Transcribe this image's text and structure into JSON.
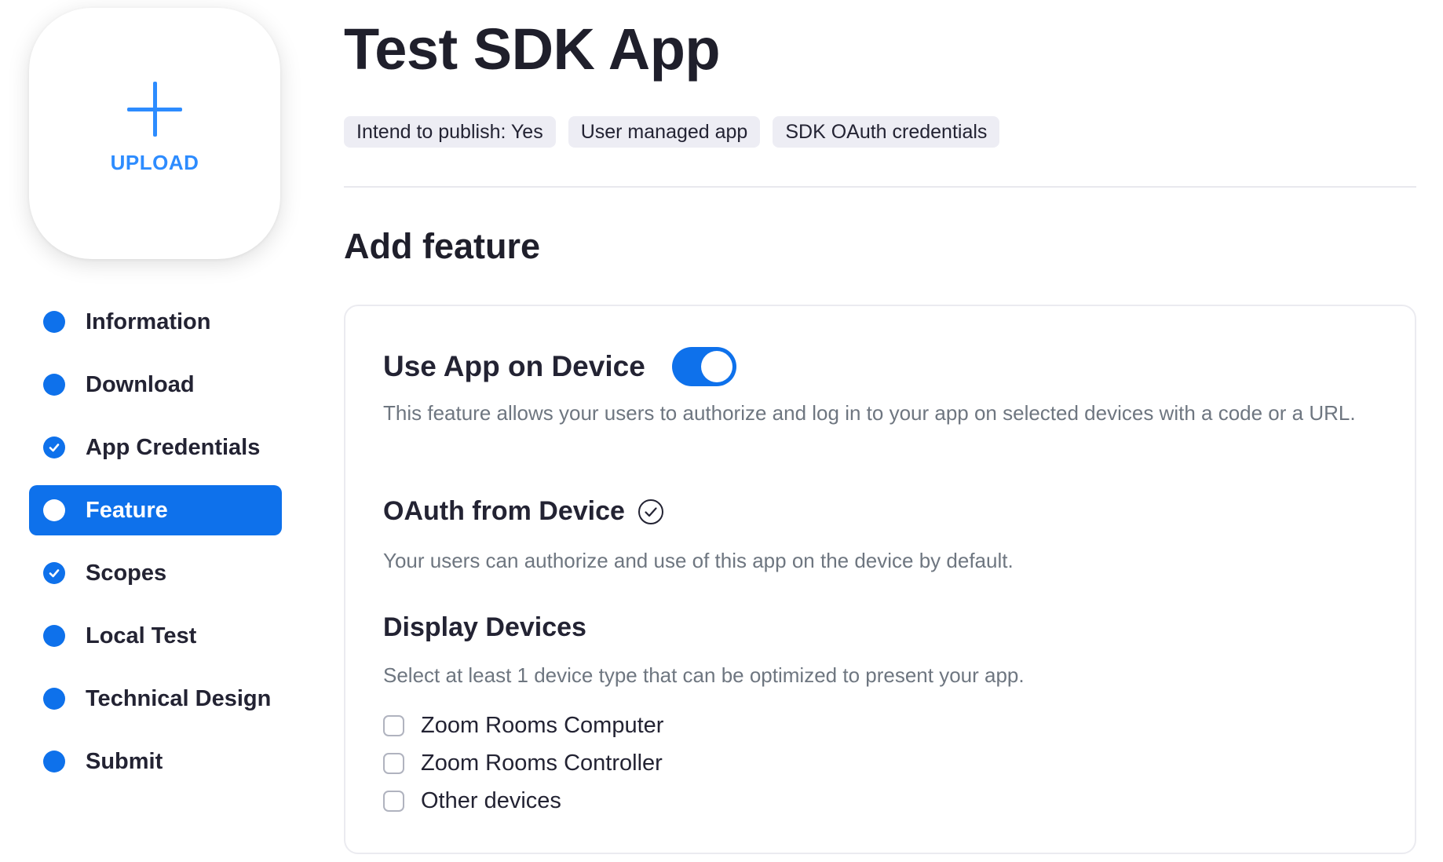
{
  "sidebar": {
    "upload_label": "UPLOAD",
    "items": [
      {
        "label": "Information",
        "state": "dot"
      },
      {
        "label": "Download",
        "state": "dot"
      },
      {
        "label": "App Credentials",
        "state": "check"
      },
      {
        "label": "Feature",
        "state": "active"
      },
      {
        "label": "Scopes",
        "state": "check"
      },
      {
        "label": "Local Test",
        "state": "dot"
      },
      {
        "label": "Technical Design",
        "state": "dot"
      },
      {
        "label": "Submit",
        "state": "dot"
      }
    ]
  },
  "header": {
    "title": "Test SDK App",
    "tags": [
      "Intend to publish: Yes",
      "User managed app",
      "SDK OAuth credentials"
    ]
  },
  "main": {
    "section_title": "Add feature",
    "use_app_on_device": {
      "title": "Use App on Device",
      "toggle_on": true,
      "description": "This feature allows your users to authorize and log in to your app on selected devices with a code or a URL."
    },
    "oauth_from_device": {
      "title": "OAuth from Device",
      "description": "Your users can authorize and use of this app on the device by default."
    },
    "display_devices": {
      "title": "Display Devices",
      "description": "Select at least 1 device type that can be optimized to present your app.",
      "options": [
        {
          "label": "Zoom Rooms Computer",
          "checked": false
        },
        {
          "label": "Zoom Rooms Controller",
          "checked": false
        },
        {
          "label": "Other devices",
          "checked": false
        }
      ]
    }
  },
  "colors": {
    "accent": "#0E71EB",
    "upload": "#2D8CFF",
    "text": "#232333",
    "muted": "#6E7680"
  }
}
